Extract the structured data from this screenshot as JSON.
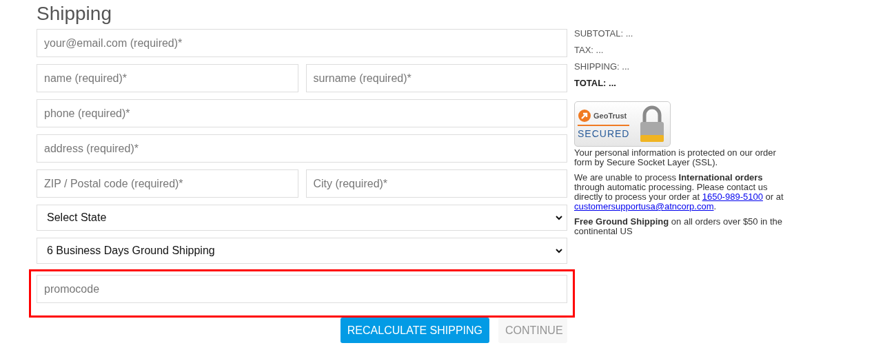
{
  "title": "Shipping",
  "form_rows": [
    [
      {
        "kind": "input",
        "placeholder": "your@email.com (required)*"
      }
    ],
    [
      {
        "kind": "input",
        "placeholder": "name (required)*"
      },
      {
        "kind": "input",
        "placeholder": "surname (required)*"
      }
    ],
    [
      {
        "kind": "input",
        "placeholder": "phone (required)*"
      }
    ],
    [
      {
        "kind": "input",
        "placeholder": "address (required)*"
      }
    ],
    [
      {
        "kind": "input",
        "placeholder": "ZIP / Postal code (required)*"
      },
      {
        "kind": "input",
        "placeholder": "City (required)*"
      }
    ],
    [
      {
        "kind": "select",
        "value": "Select State"
      }
    ],
    [
      {
        "kind": "select",
        "value": "6 Business Days Ground Shipping"
      }
    ],
    [
      {
        "kind": "input",
        "placeholder": "promocode",
        "highlighted": true
      }
    ]
  ],
  "buttons": [
    {
      "label": "RECALCULATE SHIPPING",
      "disabled": false
    },
    {
      "label": "CONTINUE",
      "disabled": true
    }
  ],
  "summary": [
    {
      "text": "SUBTOTAL: ...",
      "bold": false
    },
    {
      "text": "TAX: ...",
      "bold": false
    },
    {
      "text": "SHIPPING: ...",
      "bold": false
    },
    {
      "text": "TOTAL: ...",
      "bold": true
    }
  ],
  "badge": {
    "brand": "GeoTrust",
    "label": "SECURED"
  },
  "paragraphs": [
    [
      {
        "kind": "text",
        "text": "Your personal information is protected on our order form by Secure Socket Layer (SSL)."
      }
    ],
    [
      {
        "kind": "text",
        "text": "We are unable to process **International orders** through automatic processing. Please contact us directly to process your order at "
      },
      {
        "kind": "link",
        "text": "1650-989-5100"
      },
      {
        "kind": "text",
        "text": " or at "
      },
      {
        "kind": "link",
        "text": "customersupportusa@atncorp.com"
      },
      {
        "kind": "text",
        "text": "."
      }
    ],
    [
      {
        "kind": "text",
        "text": "**Free Ground Shipping** on all orders over $50 in the continental US"
      }
    ]
  ]
}
